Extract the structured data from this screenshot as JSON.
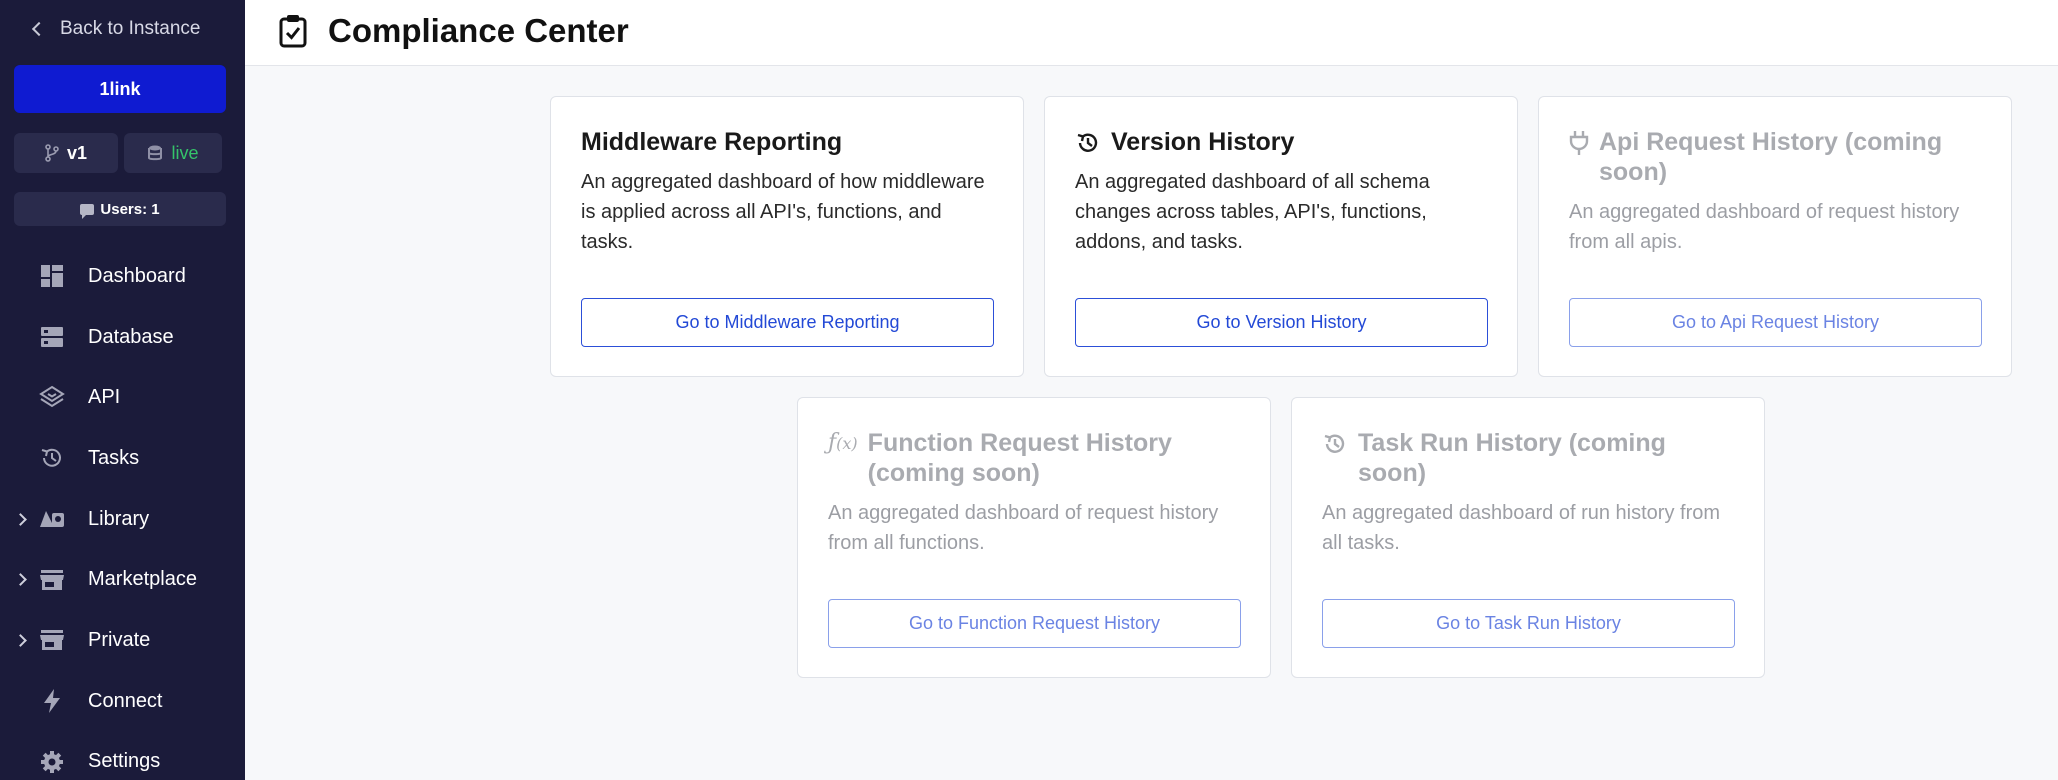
{
  "sidebar": {
    "back_label": "Back to Instance",
    "instance_name": "1link",
    "branch": "v1",
    "environment": "live",
    "users": "Users: 1",
    "items": [
      {
        "label": "Dashboard",
        "icon": "dashboard-icon",
        "expandable": false
      },
      {
        "label": "Database",
        "icon": "database-icon",
        "expandable": false
      },
      {
        "label": "API",
        "icon": "api-icon",
        "expandable": false
      },
      {
        "label": "Tasks",
        "icon": "history-icon",
        "expandable": false
      },
      {
        "label": "Library",
        "icon": "library-icon",
        "expandable": true
      },
      {
        "label": "Marketplace",
        "icon": "store-icon",
        "expandable": true
      },
      {
        "label": "Private",
        "icon": "store-icon",
        "expandable": true
      },
      {
        "label": "Connect",
        "icon": "bolt-icon",
        "expandable": false
      },
      {
        "label": "Settings",
        "icon": "gear-icon",
        "expandable": false
      }
    ]
  },
  "header": {
    "title": "Compliance Center",
    "icon": "clipboard-check-icon"
  },
  "cards": [
    {
      "title": "Middleware Reporting",
      "description": "An aggregated dashboard of how middleware is applied across all API's, functions, and tasks.",
      "button": "Go to Middleware Reporting",
      "enabled": true
    },
    {
      "title": "Version History",
      "description": "An aggregated dashboard of all schema changes across tables, API's, functions, addons, and tasks.",
      "button": "Go to Version History",
      "enabled": true,
      "icon": "history-icon"
    },
    {
      "title": "Api Request History (coming soon)",
      "description": "An aggregated dashboard of request history from all apis.",
      "button": "Go to Api Request History",
      "enabled": false,
      "icon": "plug-icon"
    },
    {
      "title": "Function Request History (coming soon)",
      "description": "An aggregated dashboard of request history from all functions.",
      "button": "Go to Function Request History",
      "enabled": false,
      "icon": "function-icon"
    },
    {
      "title": "Task Run History (coming soon)",
      "description": "An aggregated dashboard of run history from all tasks.",
      "button": "Go to Task Run History",
      "enabled": false,
      "icon": "history-icon"
    }
  ],
  "colors": {
    "sidebar_bg": "#1b1b3a",
    "instance_button": "#0f1bd1",
    "live": "#35c46a",
    "link_blue": "#2349d6"
  }
}
